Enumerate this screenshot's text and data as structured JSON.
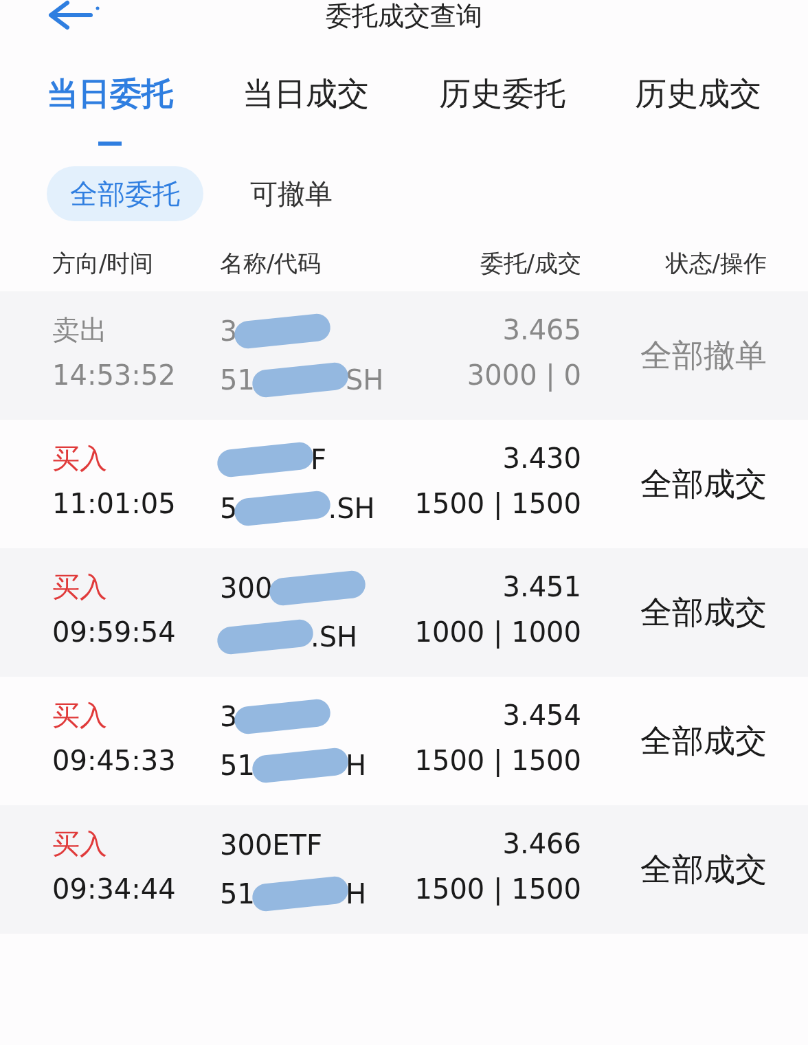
{
  "header": {
    "title": "委托成交查询"
  },
  "tabs": [
    {
      "label": "当日委托",
      "selected": true
    },
    {
      "label": "当日成交",
      "selected": false
    },
    {
      "label": "历史委托",
      "selected": false
    },
    {
      "label": "历史成交",
      "selected": false
    }
  ],
  "filters": [
    {
      "label": "全部委托",
      "selected": true
    },
    {
      "label": "可撤单",
      "selected": false
    }
  ],
  "table": {
    "columns": [
      "方向/时间",
      "名称/代码",
      "委托/成交",
      "状态/操作"
    ],
    "rows": [
      {
        "kind": "sell",
        "direction": "卖出",
        "time": "14:53:52",
        "name": {
          "prefix": "3"
        },
        "code": {
          "prefix": "51",
          "suffix": "SH"
        },
        "price": "3.465",
        "quantity": "3000 | 0",
        "status": "全部撤单",
        "cancelled": true
      },
      {
        "kind": "buy",
        "direction": "买入",
        "time": "11:01:05",
        "name": {
          "suffix": "F"
        },
        "code": {
          "prefix": "5",
          "suffix": ".SH"
        },
        "price": "3.430",
        "quantity": "1500 | 1500",
        "status": "全部成交",
        "cancelled": false
      },
      {
        "kind": "buy",
        "direction": "买入",
        "time": "09:59:54",
        "name": {
          "prefix": "300"
        },
        "code": {
          "suffix": ".SH"
        },
        "price": "3.451",
        "quantity": "1000 | 1000",
        "status": "全部成交",
        "cancelled": false
      },
      {
        "kind": "buy",
        "direction": "买入",
        "time": "09:45:33",
        "name": {
          "prefix": "3"
        },
        "code": {
          "prefix": "51",
          "suffix": "H"
        },
        "price": "3.454",
        "quantity": "1500 | 1500",
        "status": "全部成交",
        "cancelled": false
      },
      {
        "kind": "buy",
        "direction": "买入",
        "time": "09:34:44",
        "name": {
          "prefix": "300ETF"
        },
        "code": {
          "prefix": "51",
          "suffix": "H"
        },
        "price": "3.466",
        "quantity": "1500 | 1500",
        "status": "全部成交",
        "cancelled": false
      }
    ]
  }
}
